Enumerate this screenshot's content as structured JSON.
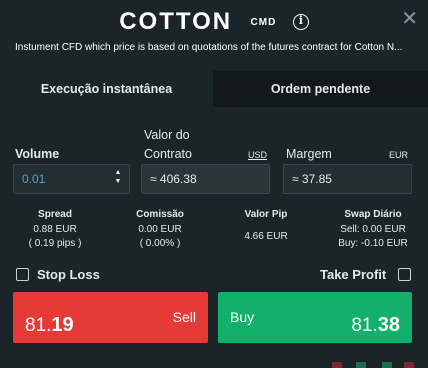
{
  "header": {
    "title": "COTTON",
    "symbol_type": "CMD",
    "info_icon_glyph": "i",
    "close_glyph": "✕",
    "subtitle": "Instument CFD which price is based on quotations of the futures contract for Cotton N..."
  },
  "tabs": [
    {
      "label": "Execução instantânea",
      "active": true
    },
    {
      "label": "Ordem pendente",
      "active": false
    }
  ],
  "volume": {
    "label": "Volume",
    "value": "0.01",
    "up_glyph": "▲",
    "down_glyph": "▼"
  },
  "contract": {
    "label_line1": "Valor do",
    "label_line2": "Contrato",
    "currency": "USD",
    "value": "≈ 406.38"
  },
  "margin": {
    "label": "Margem",
    "currency": "EUR",
    "value": "≈ 37.85"
  },
  "stats": {
    "spread": {
      "title": "Spread",
      "line1": "0.88 EUR",
      "line2": "( 0.19 pips )"
    },
    "commission": {
      "title": "Comissão",
      "line1": "0.00 EUR",
      "line2": "( 0.00% )"
    },
    "pip_value": {
      "title": "Valor Pip",
      "line1": "4.66 EUR"
    },
    "swap": {
      "title": "Swap Diário",
      "line1": "Sell: 0.00 EUR",
      "line2": "Buy: -0.10 EUR"
    }
  },
  "stop_loss": {
    "label": "Stop Loss",
    "checked": false
  },
  "take_profit": {
    "label": "Take Profit",
    "checked": false
  },
  "sell": {
    "label": "Sell",
    "price_prefix": "81.",
    "price_big": "19",
    "color": "#e63a36"
  },
  "buy": {
    "label": "Buy",
    "price_prefix": "81.",
    "price_big": "38",
    "color": "#12b06b"
  },
  "colors": {
    "background": "#1b2429",
    "tab_inactive": "#12181c",
    "accent_blue": "#4aa3df"
  }
}
